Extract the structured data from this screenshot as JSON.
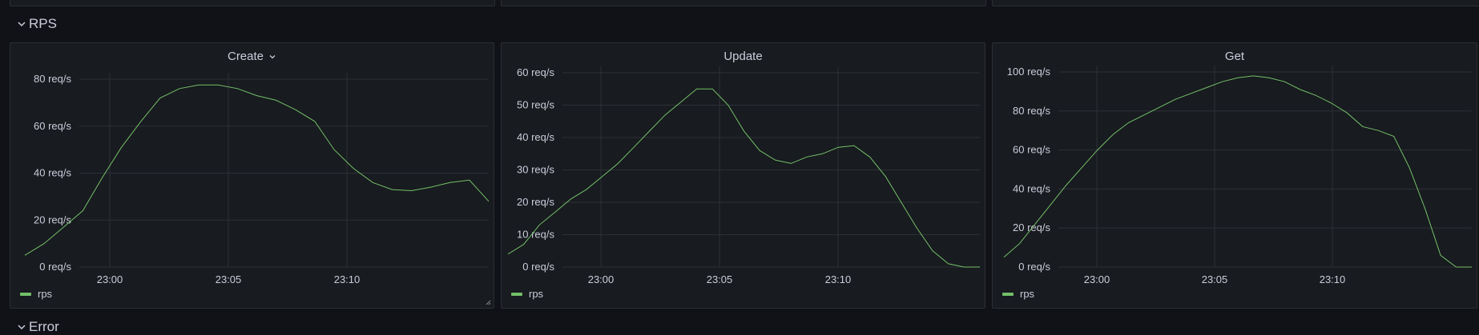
{
  "rows": {
    "rps_title": "RPS",
    "error_title": "Error"
  },
  "colors": {
    "series": "#73bf69",
    "grid": "#2c3036",
    "text": "#ccccdc"
  },
  "panels": [
    {
      "title": "Create",
      "has_menu": true,
      "legend": "rps"
    },
    {
      "title": "Update",
      "has_menu": false,
      "legend": "rps"
    },
    {
      "title": "Get",
      "has_menu": false,
      "legend": "rps"
    }
  ],
  "chart_data": [
    {
      "type": "line",
      "title": "Create",
      "x_ticks": [
        "23:00",
        "23:05",
        "23:10"
      ],
      "y_ticks": [
        "0 req/s",
        "20 req/s",
        "40 req/s",
        "60 req/s",
        "80 req/s"
      ],
      "ylim": [
        0,
        80
      ],
      "x": [
        "22:58",
        "22:58:20",
        "22:58:40",
        "22:59",
        "23:00",
        "23:01",
        "23:02",
        "23:03",
        "23:03:30",
        "23:04",
        "23:04:30",
        "23:05",
        "23:06",
        "23:06:30",
        "23:07",
        "23:08",
        "23:09",
        "23:09:30",
        "23:10",
        "23:10:30",
        "23:11",
        "23:11:30",
        "23:12",
        "23:12:30"
      ],
      "series": [
        {
          "name": "rps",
          "values": [
            5,
            10,
            17,
            24,
            38,
            51,
            62,
            72,
            76,
            77.5,
            77.5,
            76,
            73,
            71,
            67,
            62,
            50,
            42,
            36,
            33,
            32.5,
            34,
            36,
            37,
            28
          ]
        }
      ]
    },
    {
      "type": "line",
      "title": "Update",
      "x_ticks": [
        "23:05",
        "23:10",
        "23:00"
      ],
      "y_ticks": [
        "0 req/s",
        "10 req/s",
        "20 req/s",
        "30 req/s",
        "40 req/s",
        "50 req/s",
        "60 req/s"
      ],
      "ylim": [
        0,
        60
      ],
      "series": [
        {
          "name": "rps",
          "values": [
            4,
            7,
            13,
            17,
            21,
            24,
            28,
            32,
            37,
            42,
            47,
            51,
            55,
            55,
            50,
            42,
            36,
            33,
            32,
            34,
            35,
            37,
            37.5,
            34,
            28,
            20,
            12,
            5,
            1,
            0,
            0
          ]
        }
      ]
    },
    {
      "type": "line",
      "title": "Get",
      "x_ticks": [
        "23:00",
        "23:05",
        "23:10"
      ],
      "y_ticks": [
        "0 req/s",
        "20 req/s",
        "40 req/s",
        "60 req/s",
        "80 req/s",
        "100 req/s"
      ],
      "ylim": [
        0,
        100
      ],
      "series": [
        {
          "name": "rps",
          "values": [
            5,
            12,
            22,
            32,
            42,
            51,
            60,
            68,
            74,
            78,
            82,
            86,
            89,
            92,
            95,
            97,
            98,
            97,
            95,
            91,
            88,
            84,
            79,
            72,
            70,
            67,
            51,
            30,
            6,
            0,
            0
          ]
        }
      ]
    }
  ]
}
